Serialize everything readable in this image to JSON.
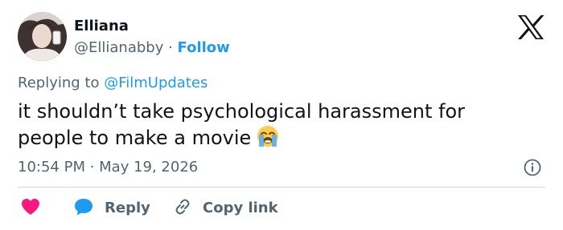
{
  "author": {
    "name": "Elliana",
    "handle": "@Ellianabby",
    "separator": " · ",
    "follow_label": "Follow",
    "avatar_icon": "profile-photo"
  },
  "brand": {
    "logo_icon": "x-logo"
  },
  "tweet": {
    "replying_prefix": "Replying to ",
    "replying_handle": "@FilmUpdates",
    "text": "it shouldn’t take psychological harassment for people to make a movie",
    "emoji": "loudly-crying-face",
    "timestamp": "10:54 PM · May 19, 2026"
  },
  "actions": {
    "like_icon": "heart-icon",
    "reply_label": "Reply",
    "copy_label": "Copy link"
  },
  "colors": {
    "accent": "#1d9bf0",
    "like": "#f91880",
    "muted": "#536471",
    "text": "#0f1419"
  }
}
